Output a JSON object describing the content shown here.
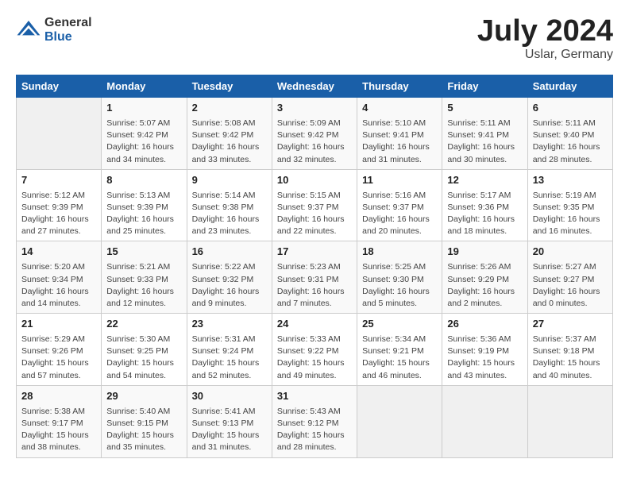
{
  "header": {
    "logo_general": "General",
    "logo_blue": "Blue",
    "month_title": "July 2024",
    "location": "Uslar, Germany"
  },
  "weekdays": [
    "Sunday",
    "Monday",
    "Tuesday",
    "Wednesday",
    "Thursday",
    "Friday",
    "Saturday"
  ],
  "weeks": [
    [
      {
        "day": "",
        "info": ""
      },
      {
        "day": "1",
        "info": "Sunrise: 5:07 AM\nSunset: 9:42 PM\nDaylight: 16 hours\nand 34 minutes."
      },
      {
        "day": "2",
        "info": "Sunrise: 5:08 AM\nSunset: 9:42 PM\nDaylight: 16 hours\nand 33 minutes."
      },
      {
        "day": "3",
        "info": "Sunrise: 5:09 AM\nSunset: 9:42 PM\nDaylight: 16 hours\nand 32 minutes."
      },
      {
        "day": "4",
        "info": "Sunrise: 5:10 AM\nSunset: 9:41 PM\nDaylight: 16 hours\nand 31 minutes."
      },
      {
        "day": "5",
        "info": "Sunrise: 5:11 AM\nSunset: 9:41 PM\nDaylight: 16 hours\nand 30 minutes."
      },
      {
        "day": "6",
        "info": "Sunrise: 5:11 AM\nSunset: 9:40 PM\nDaylight: 16 hours\nand 28 minutes."
      }
    ],
    [
      {
        "day": "7",
        "info": "Sunrise: 5:12 AM\nSunset: 9:39 PM\nDaylight: 16 hours\nand 27 minutes."
      },
      {
        "day": "8",
        "info": "Sunrise: 5:13 AM\nSunset: 9:39 PM\nDaylight: 16 hours\nand 25 minutes."
      },
      {
        "day": "9",
        "info": "Sunrise: 5:14 AM\nSunset: 9:38 PM\nDaylight: 16 hours\nand 23 minutes."
      },
      {
        "day": "10",
        "info": "Sunrise: 5:15 AM\nSunset: 9:37 PM\nDaylight: 16 hours\nand 22 minutes."
      },
      {
        "day": "11",
        "info": "Sunrise: 5:16 AM\nSunset: 9:37 PM\nDaylight: 16 hours\nand 20 minutes."
      },
      {
        "day": "12",
        "info": "Sunrise: 5:17 AM\nSunset: 9:36 PM\nDaylight: 16 hours\nand 18 minutes."
      },
      {
        "day": "13",
        "info": "Sunrise: 5:19 AM\nSunset: 9:35 PM\nDaylight: 16 hours\nand 16 minutes."
      }
    ],
    [
      {
        "day": "14",
        "info": "Sunrise: 5:20 AM\nSunset: 9:34 PM\nDaylight: 16 hours\nand 14 minutes."
      },
      {
        "day": "15",
        "info": "Sunrise: 5:21 AM\nSunset: 9:33 PM\nDaylight: 16 hours\nand 12 minutes."
      },
      {
        "day": "16",
        "info": "Sunrise: 5:22 AM\nSunset: 9:32 PM\nDaylight: 16 hours\nand 9 minutes."
      },
      {
        "day": "17",
        "info": "Sunrise: 5:23 AM\nSunset: 9:31 PM\nDaylight: 16 hours\nand 7 minutes."
      },
      {
        "day": "18",
        "info": "Sunrise: 5:25 AM\nSunset: 9:30 PM\nDaylight: 16 hours\nand 5 minutes."
      },
      {
        "day": "19",
        "info": "Sunrise: 5:26 AM\nSunset: 9:29 PM\nDaylight: 16 hours\nand 2 minutes."
      },
      {
        "day": "20",
        "info": "Sunrise: 5:27 AM\nSunset: 9:27 PM\nDaylight: 16 hours\nand 0 minutes."
      }
    ],
    [
      {
        "day": "21",
        "info": "Sunrise: 5:29 AM\nSunset: 9:26 PM\nDaylight: 15 hours\nand 57 minutes."
      },
      {
        "day": "22",
        "info": "Sunrise: 5:30 AM\nSunset: 9:25 PM\nDaylight: 15 hours\nand 54 minutes."
      },
      {
        "day": "23",
        "info": "Sunrise: 5:31 AM\nSunset: 9:24 PM\nDaylight: 15 hours\nand 52 minutes."
      },
      {
        "day": "24",
        "info": "Sunrise: 5:33 AM\nSunset: 9:22 PM\nDaylight: 15 hours\nand 49 minutes."
      },
      {
        "day": "25",
        "info": "Sunrise: 5:34 AM\nSunset: 9:21 PM\nDaylight: 15 hours\nand 46 minutes."
      },
      {
        "day": "26",
        "info": "Sunrise: 5:36 AM\nSunset: 9:19 PM\nDaylight: 15 hours\nand 43 minutes."
      },
      {
        "day": "27",
        "info": "Sunrise: 5:37 AM\nSunset: 9:18 PM\nDaylight: 15 hours\nand 40 minutes."
      }
    ],
    [
      {
        "day": "28",
        "info": "Sunrise: 5:38 AM\nSunset: 9:17 PM\nDaylight: 15 hours\nand 38 minutes."
      },
      {
        "day": "29",
        "info": "Sunrise: 5:40 AM\nSunset: 9:15 PM\nDaylight: 15 hours\nand 35 minutes."
      },
      {
        "day": "30",
        "info": "Sunrise: 5:41 AM\nSunset: 9:13 PM\nDaylight: 15 hours\nand 31 minutes."
      },
      {
        "day": "31",
        "info": "Sunrise: 5:43 AM\nSunset: 9:12 PM\nDaylight: 15 hours\nand 28 minutes."
      },
      {
        "day": "",
        "info": ""
      },
      {
        "day": "",
        "info": ""
      },
      {
        "day": "",
        "info": ""
      }
    ]
  ]
}
